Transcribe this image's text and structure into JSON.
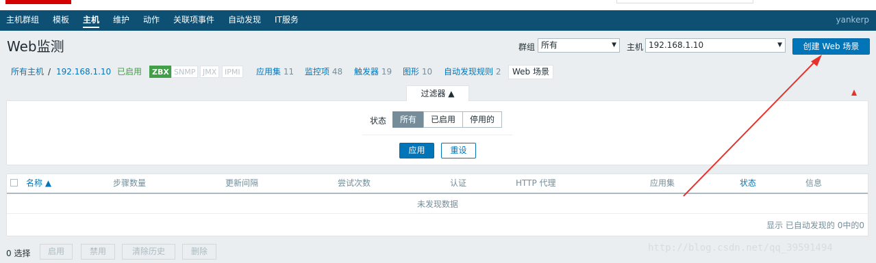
{
  "nav": {
    "items": [
      "主机群组",
      "模板",
      "主机",
      "维护",
      "动作",
      "关联项事件",
      "自动发现",
      "IT服务"
    ],
    "active": "主机",
    "user": "yankerp"
  },
  "header": {
    "title": "Web监测",
    "group_label": "群组",
    "group_value": "所有",
    "host_label": "主机",
    "host_value": "192.168.1.10",
    "create_button": "创建 Web 场景"
  },
  "breadcrumb": {
    "all_hosts": "所有主机",
    "separator": "/",
    "host": "192.168.1.10",
    "status": "已启用",
    "tags": [
      "ZBX",
      "SNMP",
      "JMX",
      "IPMI"
    ],
    "links": [
      {
        "label": "应用集",
        "count": "11"
      },
      {
        "label": "监控项",
        "count": "48"
      },
      {
        "label": "触发器",
        "count": "19"
      },
      {
        "label": "图形",
        "count": "10"
      },
      {
        "label": "自动发现规则",
        "count": "2"
      }
    ],
    "web_tab": "Web 场景"
  },
  "filter": {
    "tab_label": "过滤器 ▲",
    "status_label": "状态",
    "options": [
      "所有",
      "已启用",
      "停用的"
    ],
    "selected": "所有",
    "apply": "应用",
    "reset": "重设"
  },
  "table": {
    "columns": [
      "名称 ▲",
      "步骤数量",
      "更新间隔",
      "尝试次数",
      "认证",
      "HTTP 代理",
      "应用集",
      "状态",
      "信息"
    ],
    "empty_message": "未发现数据",
    "footer": "显示 已自动发现的 0中的0"
  },
  "bottom": {
    "selected_count": "0 选择",
    "actions": [
      "启用",
      "禁用",
      "清除历史",
      "删除"
    ]
  },
  "watermark": "http://blog.csdn.net/qq_39591494",
  "colors": {
    "nav_bg": "#0e5074",
    "primary": "#0275b8",
    "green": "#429e47",
    "annotation": "#e8312b"
  }
}
